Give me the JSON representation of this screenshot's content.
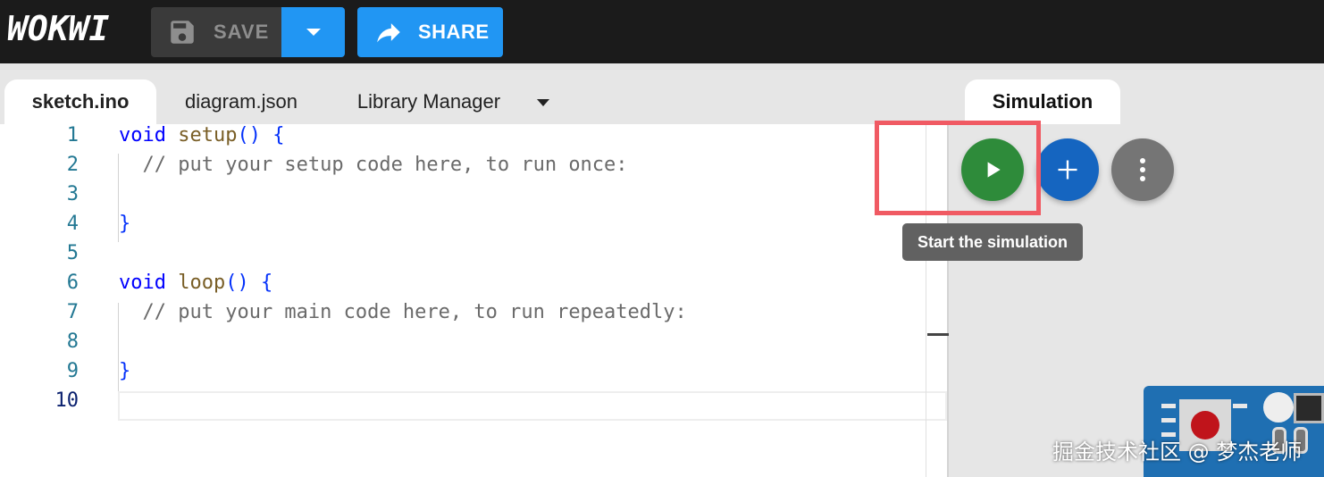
{
  "app": {
    "logo_text": "WOKWI"
  },
  "toolbar": {
    "save_label": "SAVE",
    "save_icon": "floppy-disk-icon",
    "save_dropdown_icon": "caret-down-icon",
    "share_label": "SHARE",
    "share_icon": "share-arrow-icon",
    "accent_color": "#2196f3"
  },
  "editor": {
    "tabs": [
      {
        "label": "sketch.ino",
        "active": true
      },
      {
        "label": "diagram.json",
        "active": false
      },
      {
        "label": "Library Manager",
        "active": false
      }
    ],
    "more_tabs_icon": "caret-down-icon",
    "current_line": 10,
    "lines": [
      {
        "n": "1"
      },
      {
        "n": "2"
      },
      {
        "n": "3"
      },
      {
        "n": "4"
      },
      {
        "n": "5"
      },
      {
        "n": "6"
      },
      {
        "n": "7"
      },
      {
        "n": "8"
      },
      {
        "n": "9"
      },
      {
        "n": "10"
      }
    ],
    "tokens": {
      "l1_kw": "void",
      "l1_fn": "setup",
      "l1_rest": "() {",
      "l2_comment": "  // put your setup code here, to run once:",
      "l4_brace": "}",
      "l6_kw": "void",
      "l6_fn": "loop",
      "l6_rest": "() {",
      "l7_comment": "  // put your main code here, to run repeatedly:",
      "l9_brace": "}"
    }
  },
  "simulation": {
    "tab_label": "Simulation",
    "play_icon": "play-icon",
    "add_icon": "plus-icon",
    "more_icon": "more-vertical-icon",
    "play_color": "#2e8b3a",
    "add_color": "#1565c0",
    "more_color": "#757575",
    "tooltip": "Start the simulation",
    "highlight_color": "#f05a63"
  },
  "watermark": "掘金技术社区 @ 梦杰老师"
}
